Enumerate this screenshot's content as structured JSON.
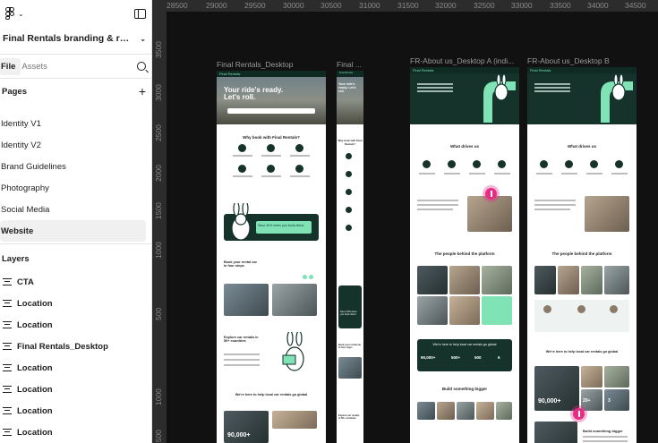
{
  "app": {
    "file_name": "Final Rentals branding & rol...",
    "tabs": {
      "file": "File",
      "assets": "Assets"
    },
    "pages_heading": "Pages",
    "pages": [
      "Identity V1",
      "Identity V2",
      "Brand Guidelines",
      "Photography",
      "Social Media",
      "Website"
    ],
    "active_page": "Website",
    "layers_heading": "Layers",
    "layers": [
      "CTA",
      "Location",
      "Location",
      "Final Rentals_Desktop",
      "Location",
      "Location",
      "Location",
      "Location"
    ]
  },
  "canvas": {
    "ruler_x": [
      "28500",
      "29000",
      "29500",
      "30000",
      "30500",
      "31000",
      "31500",
      "32000",
      "32500",
      "33000",
      "33500",
      "34000",
      "34500"
    ],
    "ruler_y": [
      "3500",
      "3000",
      "2500",
      "2000",
      "1500",
      "1000",
      "500",
      "1000",
      "1500"
    ],
    "frames": [
      {
        "label": "Final Rentals_Desktop",
        "brand": "Final Rentals",
        "hero_title": "Your ride's ready. Let's roll.",
        "why_title": "Why book with Final Rentals?",
        "save_banner": "Save 40% when you book direct.",
        "book_title": "Book your rental car in four steps",
        "explore_title": "Explore car rentals in 50+ countries",
        "help_title": "We're here to help local car rentals go global",
        "stat": "90,000+"
      },
      {
        "label": "Final ...",
        "brand": "Final Rentals",
        "hero_title": "Your ride's ready. Let's roll.",
        "why_title": "Why book with Final Rentals?",
        "save_banner": "Save 40% when you book direct.",
        "book_title": "Book your rental car in four steps",
        "explore_title": "Explore car rentals in 50+ countries"
      },
      {
        "label": "FR-About us_Desktop A (indi...",
        "brand": "Final Rentals",
        "drives_title": "What drives us",
        "people_title": "The people behind the platform",
        "help_title": "We're here to help local car rentals go global",
        "stats": [
          "90,000+",
          "500+",
          "500",
          "6"
        ],
        "build_title": "Build something bigger"
      },
      {
        "label": "FR-About us_Desktop B",
        "brand": "Final Rentals",
        "drives_title": "What drives us",
        "people_title": "The people behind the platform",
        "help_title": "We're here to help local car rentals go global",
        "stats": [
          "90,000+",
          "20+",
          "3"
        ],
        "build_title": "Build something bigger"
      }
    ]
  },
  "colors": {
    "brand_dark": "#15332b",
    "brand_mint": "#7fe3b5",
    "cursor": "#e62d86"
  }
}
